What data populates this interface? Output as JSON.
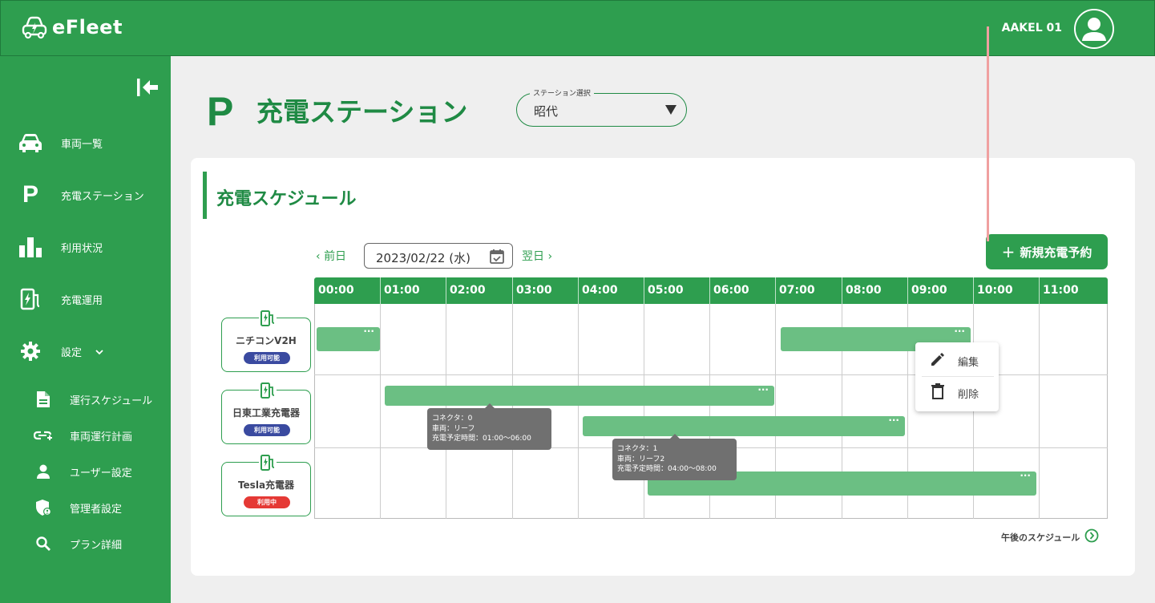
{
  "app": {
    "name": "eFleet",
    "user": "AAKEL 01"
  },
  "sidebar": {
    "items": [
      {
        "label": "車両一覧",
        "icon": "car-icon"
      },
      {
        "label": "充電ステーション",
        "icon": "parking-icon"
      },
      {
        "label": "利用状況",
        "icon": "bar-chart-icon"
      },
      {
        "label": "充電運用",
        "icon": "charger-icon"
      },
      {
        "label": "設定",
        "icon": "gear-icon"
      }
    ],
    "sub_items": [
      {
        "label": "運行スケジュール",
        "icon": "document-icon"
      },
      {
        "label": "車両運行計画",
        "icon": "route-add-icon"
      },
      {
        "label": "ユーザー設定",
        "icon": "person-icon"
      },
      {
        "label": "管理者設定",
        "icon": "admin-shield-icon"
      },
      {
        "label": "プラン詳細",
        "icon": "search-icon"
      }
    ]
  },
  "page": {
    "title_icon": "P",
    "title": "充電ステーション",
    "station_select": {
      "legend": "ステーション選択",
      "value": "昭代"
    }
  },
  "schedule": {
    "title": "充電スケジュール",
    "prev_label": "前日",
    "next_label": "翌日",
    "date": "2023/02/22 (水)",
    "new_button": "新規充電予約",
    "hours": [
      "00:00",
      "01:00",
      "02:00",
      "03:00",
      "04:00",
      "05:00",
      "06:00",
      "07:00",
      "08:00",
      "09:00",
      "10:00",
      "11:00"
    ],
    "current_time_hours": 10.5,
    "stations": [
      {
        "name": "ニチコンV2H",
        "status": "利用可能",
        "status_color": "#3a4aa0"
      },
      {
        "name": "日東工業充電器",
        "status": "利用可能",
        "status_color": "#3a4aa0"
      },
      {
        "name": "Tesla充電器",
        "status": "利用中",
        "status_color": "#e53935"
      }
    ],
    "tooltips": [
      {
        "line1": "コネクタ：0",
        "line2": "車両：リーフ",
        "line3": "充電予定時間：01:00〜06:00"
      },
      {
        "line1": "コネクタ：1",
        "line2": "車両：リーフ2",
        "line3": "充電予定時間：04:00〜08:00"
      }
    ],
    "context_menu": {
      "edit": "編集",
      "delete": "削除"
    },
    "more_label": "···",
    "afternoon_link": "午後のスケジュール"
  },
  "colors": {
    "brand": "#2e9e4f",
    "bar": "#6bbf83",
    "now_line": "#f0a0a0"
  }
}
